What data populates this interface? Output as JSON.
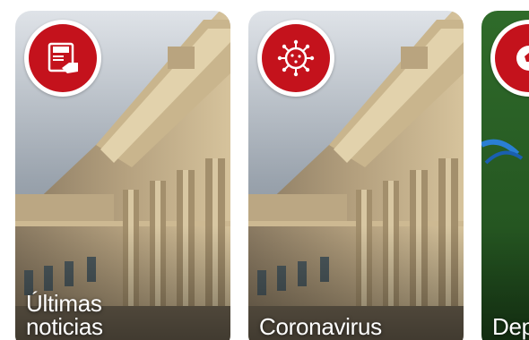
{
  "carousel": {
    "cards": [
      {
        "title_line1": "Últimas",
        "title_line2": "noticias",
        "icon": "news-tablet-icon"
      },
      {
        "title": "Coronavirus",
        "icon": "virus-icon"
      },
      {
        "title": "Dep",
        "icon": "soccer-ball-icon"
      }
    ]
  },
  "colors": {
    "badge_red": "#c4121c",
    "badge_ring": "#ffffff",
    "title_text": "#ffffff"
  }
}
